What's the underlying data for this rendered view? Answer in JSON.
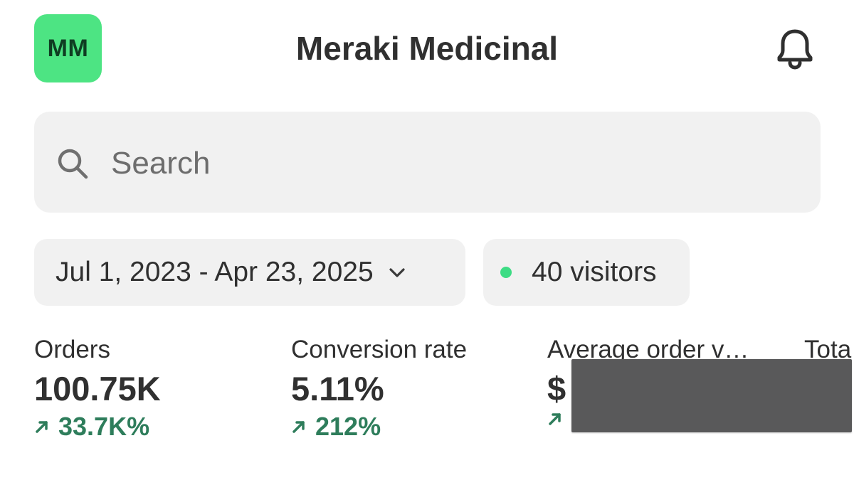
{
  "header": {
    "avatar_initials": "MM",
    "title": "Meraki Medicinal",
    "bell_icon": "bell-icon"
  },
  "search": {
    "placeholder": "Search",
    "icon": "search-icon"
  },
  "filters": {
    "date_range": "Jul 1, 2023 - Apr 23, 2025",
    "visitors": "40 visitors"
  },
  "metrics": [
    {
      "label": "Orders",
      "value": "100.75K",
      "change": "33.7K%"
    },
    {
      "label": "Conversion rate",
      "value": "5.11%",
      "change": "212%"
    },
    {
      "label": "Average order v…",
      "value": "$",
      "change": ""
    },
    {
      "label": "Tota",
      "value": "",
      "change": ""
    }
  ],
  "colors": {
    "avatar_bg": "#4de483",
    "avatar_text": "#0f3d22",
    "accent_green": "#2e7d5b",
    "status_dot": "#3ddc84",
    "redaction": "#59595a"
  }
}
